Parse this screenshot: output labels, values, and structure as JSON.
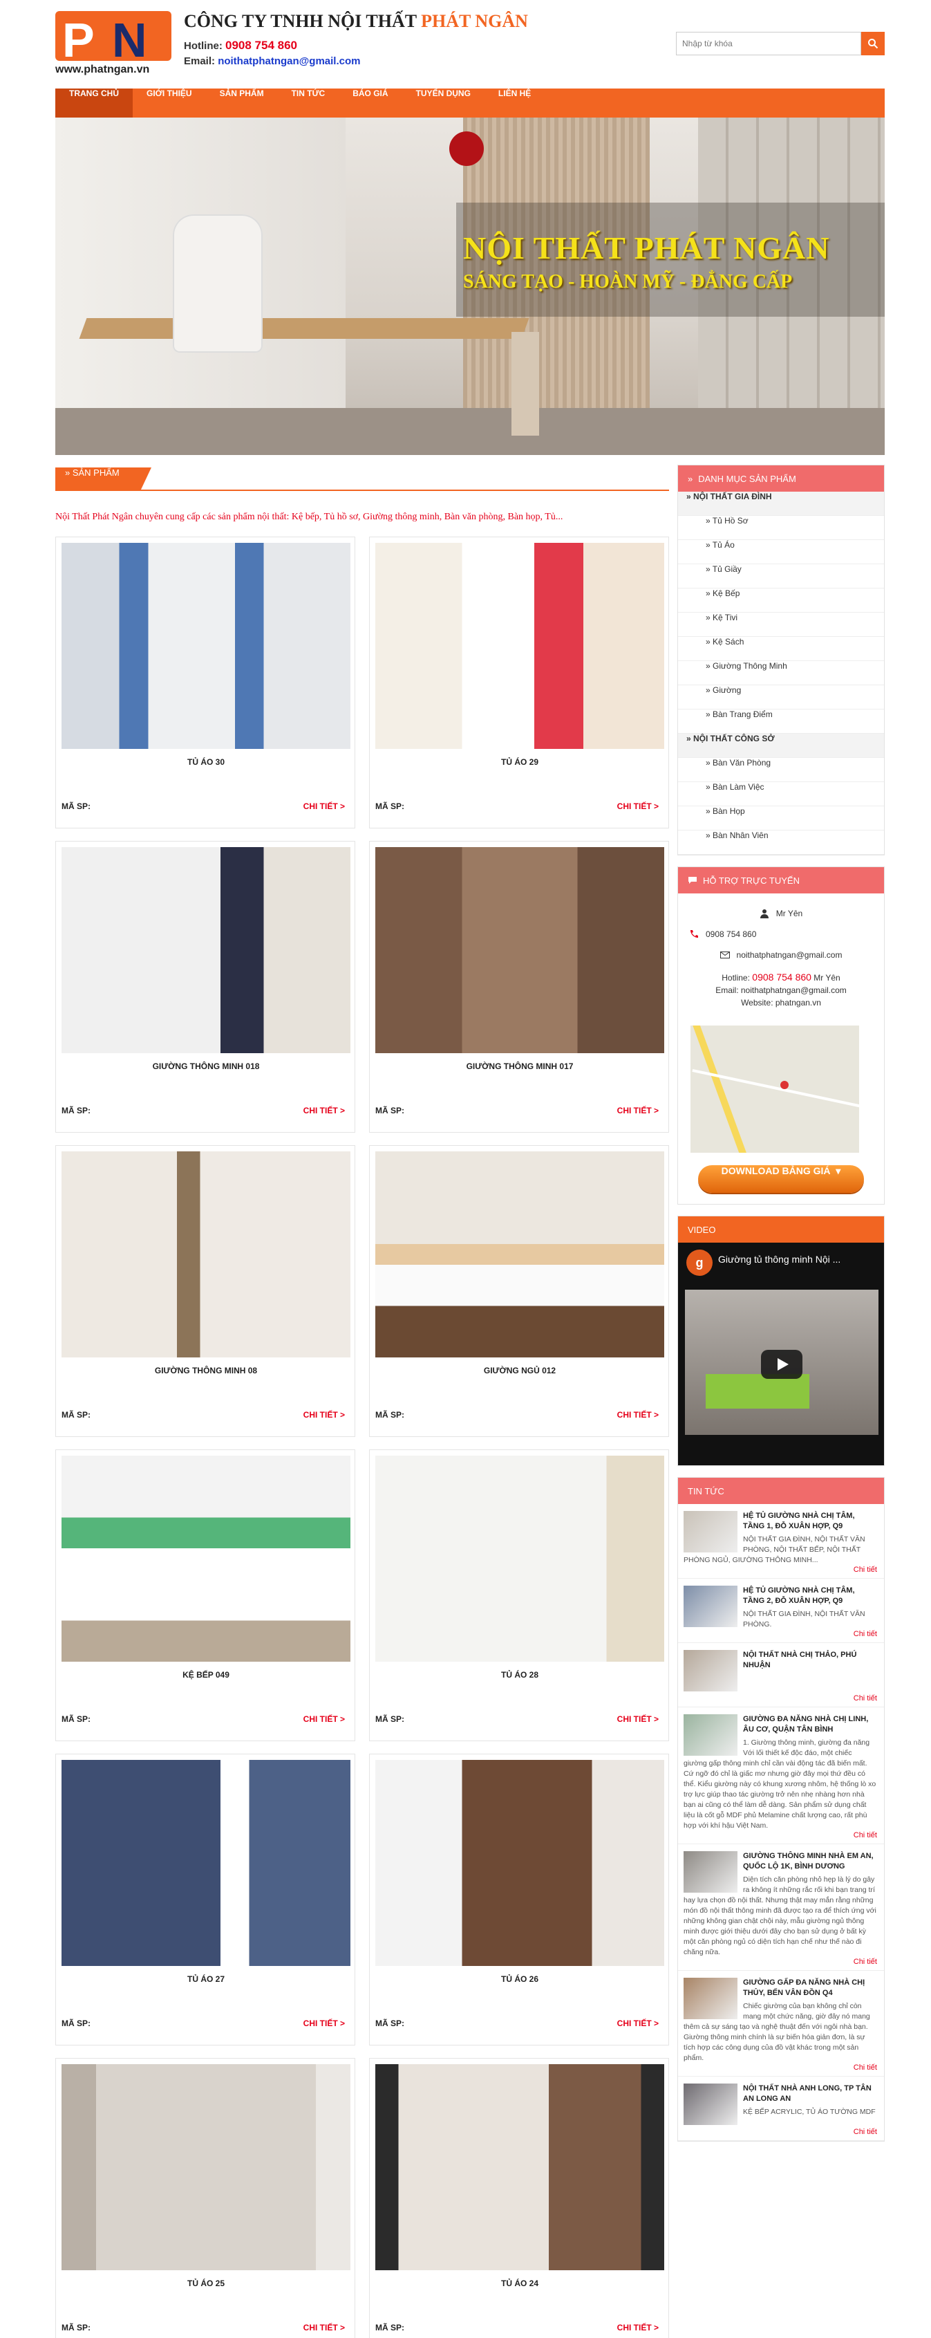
{
  "header": {
    "logo_url_text": "www.phatngan.vn",
    "logo_letters": [
      "P",
      "N"
    ],
    "company_prefix": "CÔNG TY TNHH NỘI THẤT",
    "company_brand": "PHÁT NGÂN",
    "hotline_label": "Hotline:",
    "hotline_value": "0908 754 860",
    "email_label": "Email:",
    "email_value": "noithatphatngan@gmail.com",
    "search_placeholder": "Nhập từ khóa"
  },
  "nav": [
    {
      "label": "Trang chủ",
      "active": true
    },
    {
      "label": "Giới thiệu"
    },
    {
      "label": "Sản phẩm"
    },
    {
      "label": "Tin tức"
    },
    {
      "label": "Báo giá"
    },
    {
      "label": "Tuyển dụng"
    },
    {
      "label": "Liên hệ"
    }
  ],
  "banner": {
    "title": "NỘI THẤT PHÁT NGÂN",
    "subtitle": "SÁNG TẠO - HOÀN MỸ - ĐẲNG  CẤP"
  },
  "products_section": {
    "heading": "» SẢN PHẨM",
    "intro": "Nội Thất Phát Ngân chuyên cung cấp các sản phẩm nội thất: Kệ bếp, Tủ hồ sơ, Giường thông minh, Bàn văn phòng, Bàn họp, Tủ...",
    "code_label": "MÃ SP:",
    "more_label": "CHI TIẾT >",
    "items": [
      {
        "name": "TỦ ÁO 30"
      },
      {
        "name": "TỦ ÁO 29"
      },
      {
        "name": "GIƯỜNG THÔNG MINH 018"
      },
      {
        "name": "GIƯỜNG THÔNG MINH 017"
      },
      {
        "name": "GIƯỜNG THÔNG MINH 08"
      },
      {
        "name": "GIƯỜNG NGỦ 012"
      },
      {
        "name": "KỆ BẾP 049"
      },
      {
        "name": "TỦ ÁO 28"
      },
      {
        "name": "TỦ ÁO 27"
      },
      {
        "name": "TỦ ÁO 26"
      },
      {
        "name": "TỦ ÁO 25"
      },
      {
        "name": "TỦ ÁO 24"
      }
    ]
  },
  "categories": {
    "heading": "DANH MỤC SẢN PHẨM",
    "rows": [
      {
        "label": "» NỘI THẤT GIA ĐÌNH",
        "type": "group"
      },
      {
        "label": "» Tủ Hồ Sơ",
        "type": "child"
      },
      {
        "label": "» Tủ Áo",
        "type": "child"
      },
      {
        "label": "» Tủ Giầy",
        "type": "child"
      },
      {
        "label": "» Kệ Bếp",
        "type": "child"
      },
      {
        "label": "» Kệ Tivi",
        "type": "child"
      },
      {
        "label": "» Kệ Sách",
        "type": "child"
      },
      {
        "label": "» Giường Thông Minh",
        "type": "child"
      },
      {
        "label": "» Giường",
        "type": "child"
      },
      {
        "label": "» Bàn Trang Điểm",
        "type": "child"
      },
      {
        "label": "» NỘI THẤT CÔNG SỞ",
        "type": "group"
      },
      {
        "label": "» Bàn Văn Phòng",
        "type": "child"
      },
      {
        "label": "» Bàn Làm Việc",
        "type": "child"
      },
      {
        "label": "» Bàn Họp",
        "type": "child"
      },
      {
        "label": "» Bàn Nhân Viên",
        "type": "child"
      }
    ]
  },
  "support": {
    "heading": "HỖ TRỢ TRỰC TUYẾN",
    "name": "Mr Yên",
    "phone": "0908 754 860",
    "email": "noithatphatngan@gmail.com",
    "hotline_label": "Hotline:",
    "hotline_value": "0908 754 860",
    "hotline_suffix": "Mr Yên",
    "email_line": "Email: noithatphatngan@gmail.com",
    "website_line": "Website: phatngan.vn",
    "download_label": "DOWNLOAD BẢNG GIÁ"
  },
  "video": {
    "heading": "VIDEO",
    "title": "Giường tủ thông minh Nội ...",
    "channel_letter": "g"
  },
  "news": {
    "heading": "TIN TỨC",
    "more_label": "Chi tiết",
    "items": [
      {
        "title": "HỆ TỦ GIƯỜNG NHÀ CHỊ TÂM, TẦNG 1, ĐỖ XUÂN HỢP, Q9",
        "text": "NỘI THẤT GIA ĐÌNH, NỘI THẤT VĂN PHÒNG, NỘI THẤT BẾP, NỘI THẤT PHÒNG NGỦ, GIƯỜNG THÔNG MINH..."
      },
      {
        "title": "HỆ TỦ GIƯỜNG NHÀ CHỊ TÂM, TẦNG 2, ĐỖ XUÂN HỢP, Q9",
        "text": "NỘI THẤT GIA ĐÌNH, NỘI THẤT VĂN PHÒNG."
      },
      {
        "title": "NỘI THẤT NHÀ CHỊ THẢO, PHÚ NHUẬN",
        "text": ""
      },
      {
        "title": "GIƯỜNG ĐA NĂNG NHÀ CHỊ LINH, ÂU CƠ, QUẬN TÂN BÌNH",
        "text": "1. Giường thông minh, giường đa năng Với lối thiết kế độc đáo, một chiếc giường gấp thông minh chỉ cần vài động tác đã biến mất. Cứ ngỡ đó chỉ là giấc mơ nhưng giờ đây mọi thứ đều có thể. Kiểu giường này có khung xương nhôm, hệ thống lò xo trợ lực giúp thao tác giường trở nên nhẹ nhàng hơn nhà bạn ai cũng có thể làm dễ dàng. Sản phẩm sử dụng chất liệu là cốt gỗ MDF phủ Melamine chất lượng cao, rất phù hợp với khí hậu Việt Nam."
      },
      {
        "title": "GIƯỜNG THÔNG MINH NHÀ EM AN, QUỐC LỘ 1K, BÌNH DƯƠNG",
        "text": "Diện tích căn phòng nhỏ hẹp là lý do gây ra không ít những rắc rối khi bạn trang trí hay lựa chọn đồ nội thất. Nhưng thật may mắn rằng những món đồ nội thất thông minh đã được tạo ra để thích ứng với những không gian chật chội này, mẫu giường ngủ thông minh được giới thiệu dưới đây cho bạn sử dụng ở bất kỳ một căn phòng ngủ có diện tích hạn chế như thế nào đi chăng nữa."
      },
      {
        "title": "GIƯỜNG GẤP ĐA NĂNG NHÀ CHỊ THỦY, BẾN VÂN ĐỒN Q4",
        "text": "Chiếc giường của bạn không chỉ còn mang một chức năng, giờ đây nó mang thêm cả sự sáng tạo và nghệ thuật đến với ngôi nhà bạn. Giường thông minh chính là sự biến hóa giản đơn, là sự tích hợp các công dụng của đồ vật khác trong một sản phẩm."
      },
      {
        "title": "NỘI THẤT NHÀ ANH LONG, TP TÂN AN LONG AN",
        "text": "KỆ BẾP ACRYLIC, TỦ ÁO TƯỜNG MDF"
      }
    ]
  },
  "colors": {
    "accent": "#f26522",
    "sidebar_header": "#f06b6b",
    "link_red": "#e5001a"
  }
}
